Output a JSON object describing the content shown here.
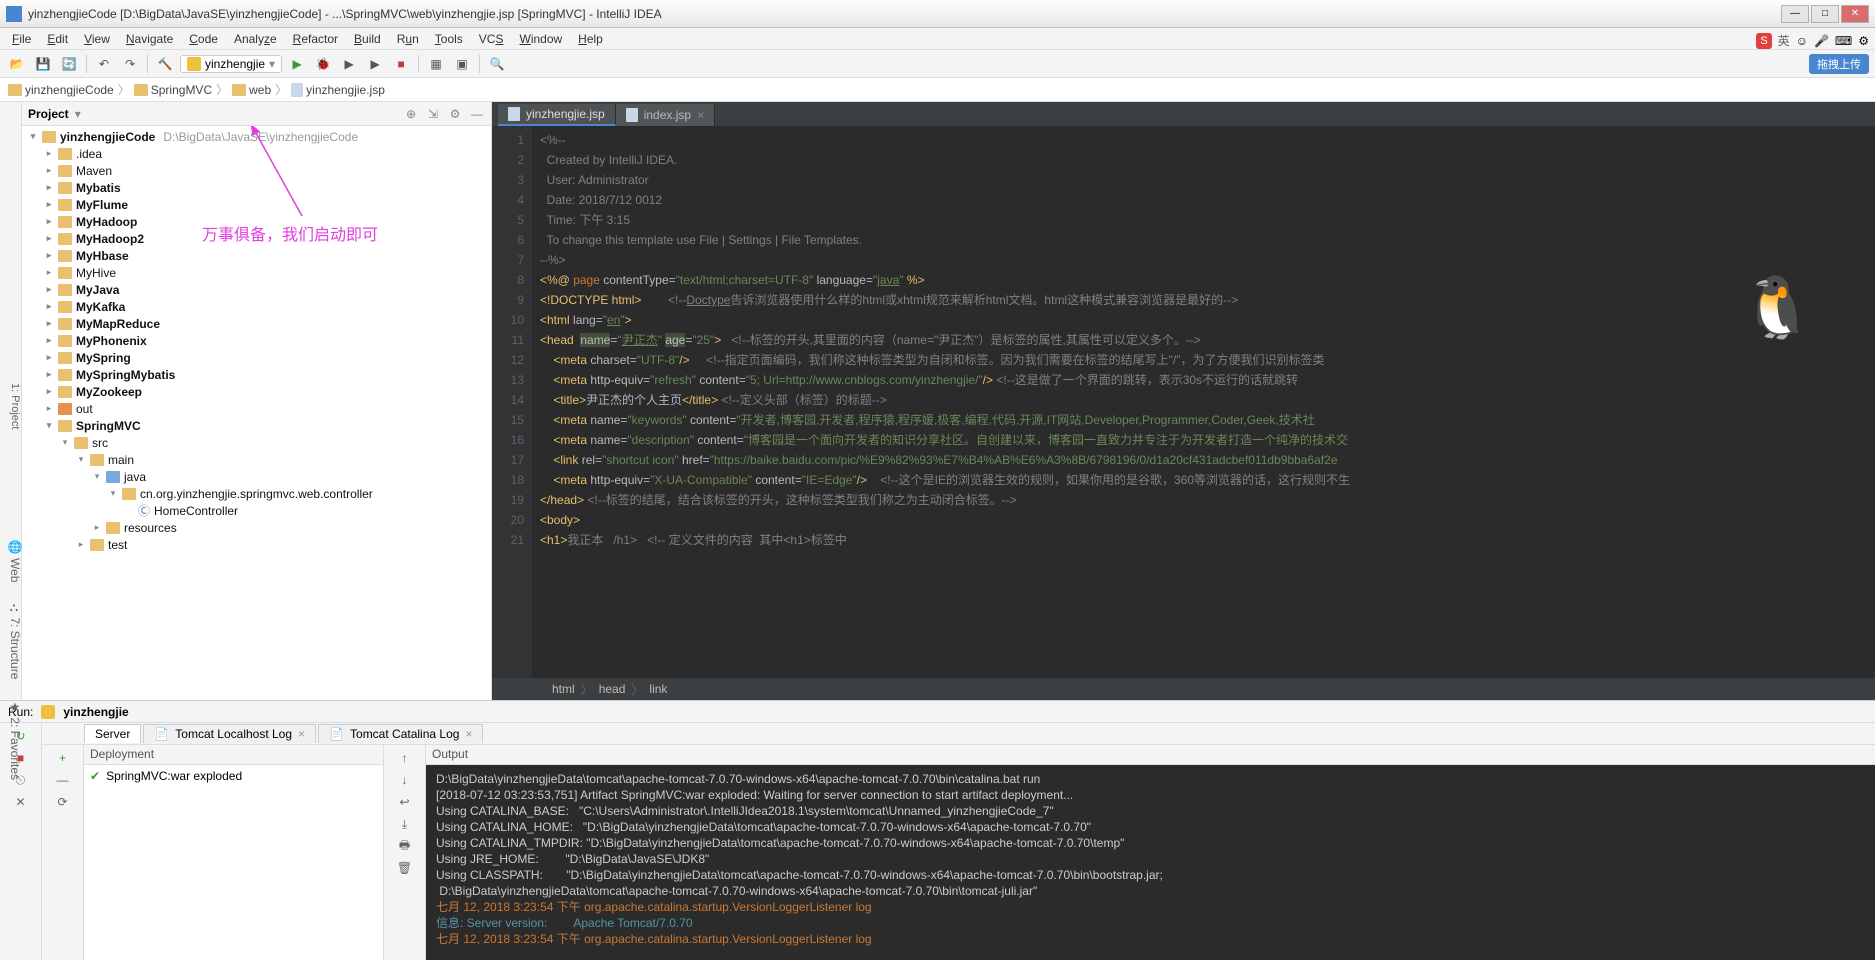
{
  "window": {
    "title": "yinzhengjieCode [D:\\BigData\\JavaSE\\yinzhengjieCode] - ...\\SpringMVC\\web\\yinzhengjie.jsp [SpringMVC] - IntelliJ IDEA"
  },
  "menu": [
    "File",
    "Edit",
    "View",
    "Navigate",
    "Code",
    "Analyze",
    "Refactor",
    "Build",
    "Run",
    "Tools",
    "VCS",
    "Window",
    "Help"
  ],
  "runConfig": "yinzhengjie",
  "breadcrumb": [
    "yinzhengjieCode",
    "SpringMVC",
    "web",
    "yinzhengjie.jsp"
  ],
  "projectTool": {
    "label": "Project",
    "sideLabel": "1: Project"
  },
  "tree": {
    "root": {
      "name": "yinzhengjieCode",
      "path": "D:\\BigData\\JavaSE\\yinzhengjieCode"
    },
    "items": [
      {
        "depth": 1,
        "arrow": ">",
        "name": ".idea",
        "bold": false
      },
      {
        "depth": 1,
        "arrow": ">",
        "name": "Maven",
        "bold": false
      },
      {
        "depth": 1,
        "arrow": ">",
        "name": "Mybatis",
        "bold": true
      },
      {
        "depth": 1,
        "arrow": ">",
        "name": "MyFlume",
        "bold": true
      },
      {
        "depth": 1,
        "arrow": ">",
        "name": "MyHadoop",
        "bold": true
      },
      {
        "depth": 1,
        "arrow": ">",
        "name": "MyHadoop2",
        "bold": true
      },
      {
        "depth": 1,
        "arrow": ">",
        "name": "MyHbase",
        "bold": true
      },
      {
        "depth": 1,
        "arrow": ">",
        "name": "MyHive",
        "bold": false
      },
      {
        "depth": 1,
        "arrow": ">",
        "name": "MyJava",
        "bold": true
      },
      {
        "depth": 1,
        "arrow": ">",
        "name": "MyKafka",
        "bold": true
      },
      {
        "depth": 1,
        "arrow": ">",
        "name": "MyMapReduce",
        "bold": true
      },
      {
        "depth": 1,
        "arrow": ">",
        "name": "MyPhonenix",
        "bold": true
      },
      {
        "depth": 1,
        "arrow": ">",
        "name": "MySpring",
        "bold": true
      },
      {
        "depth": 1,
        "arrow": ">",
        "name": "MySpringMybatis",
        "bold": true
      },
      {
        "depth": 1,
        "arrow": ">",
        "name": "MyZookeep",
        "bold": true
      },
      {
        "depth": 1,
        "arrow": ">",
        "name": "out",
        "bold": false,
        "orange": true
      },
      {
        "depth": 1,
        "arrow": "v",
        "name": "SpringMVC",
        "bold": true
      },
      {
        "depth": 2,
        "arrow": "v",
        "name": "src",
        "bold": false
      },
      {
        "depth": 3,
        "arrow": "v",
        "name": "main",
        "bold": false
      },
      {
        "depth": 4,
        "arrow": "v",
        "name": "java",
        "bold": false,
        "blue": true
      },
      {
        "depth": 5,
        "arrow": "v",
        "name": "cn.org.yinzhengjie.springmvc.web.controller",
        "bold": false
      },
      {
        "depth": 6,
        "arrow": "",
        "name": "HomeController",
        "bold": false,
        "class": true
      },
      {
        "depth": 4,
        "arrow": ">",
        "name": "resources",
        "bold": false
      },
      {
        "depth": 3,
        "arrow": ">",
        "name": "test",
        "bold": false
      }
    ]
  },
  "annotation": "万事俱备，我们启动即可",
  "editorTabs": [
    {
      "name": "yinzhengjie.jsp",
      "active": true
    },
    {
      "name": "index.jsp",
      "active": false
    }
  ],
  "code": {
    "lines": [
      1,
      2,
      3,
      4,
      5,
      6,
      7,
      8,
      9,
      10,
      11,
      12,
      13,
      14,
      15,
      16,
      17,
      18,
      19,
      20,
      21
    ]
  },
  "navpath": [
    "html",
    "head",
    "link"
  ],
  "run": {
    "label": "Run:",
    "config": "yinzhengjie",
    "tabs": [
      {
        "name": "Server",
        "active": true,
        "closable": false
      },
      {
        "name": "Tomcat Localhost Log",
        "active": false,
        "closable": true
      },
      {
        "name": "Tomcat Catalina Log",
        "active": false,
        "closable": true
      }
    ],
    "deployment": {
      "header": "Deployment",
      "item": "SpringMVC:war exploded"
    },
    "output": {
      "header": "Output",
      "lines": [
        {
          "c": "white",
          "t": "D:\\BigData\\yinzhengjieData\\tomcat\\apache-tomcat-7.0.70-windows-x64\\apache-tomcat-7.0.70\\bin\\catalina.bat run"
        },
        {
          "c": "white",
          "t": "[2018-07-12 03:23:53,751] Artifact SpringMVC:war exploded: Waiting for server connection to start artifact deployment..."
        },
        {
          "c": "white",
          "t": "Using CATALINA_BASE:   \"C:\\Users\\Administrator\\.IntelliJIdea2018.1\\system\\tomcat\\Unnamed_yinzhengjieCode_7\""
        },
        {
          "c": "white",
          "t": "Using CATALINA_HOME:   \"D:\\BigData\\yinzhengjieData\\tomcat\\apache-tomcat-7.0.70-windows-x64\\apache-tomcat-7.0.70\""
        },
        {
          "c": "white",
          "t": "Using CATALINA_TMPDIR: \"D:\\BigData\\yinzhengjieData\\tomcat\\apache-tomcat-7.0.70-windows-x64\\apache-tomcat-7.0.70\\temp\""
        },
        {
          "c": "white",
          "t": "Using JRE_HOME:        \"D:\\BigData\\JavaSE\\JDK8\""
        },
        {
          "c": "white",
          "t": "Using CLASSPATH:       \"D:\\BigData\\yinzhengjieData\\tomcat\\apache-tomcat-7.0.70-windows-x64\\apache-tomcat-7.0.70\\bin\\bootstrap.jar;"
        },
        {
          "c": "white",
          "t": " D:\\BigData\\yinzhengjieData\\tomcat\\apache-tomcat-7.0.70-windows-x64\\apache-tomcat-7.0.70\\bin\\tomcat-juli.jar\""
        },
        {
          "c": "orange",
          "t": "七月 12, 2018 3:23:54 下午 org.apache.catalina.startup.VersionLoggerListener log"
        },
        {
          "c": "cyan",
          "t": "信息: Server version:        Apache Tomcat/7.0.70"
        },
        {
          "c": "orange",
          "t": "七月 12, 2018 3:23:54 下午 org.apache.catalina.startup.VersionLoggerListener log"
        }
      ]
    }
  },
  "topright": {
    "badge": "拖拽上传",
    "ime": "英"
  }
}
